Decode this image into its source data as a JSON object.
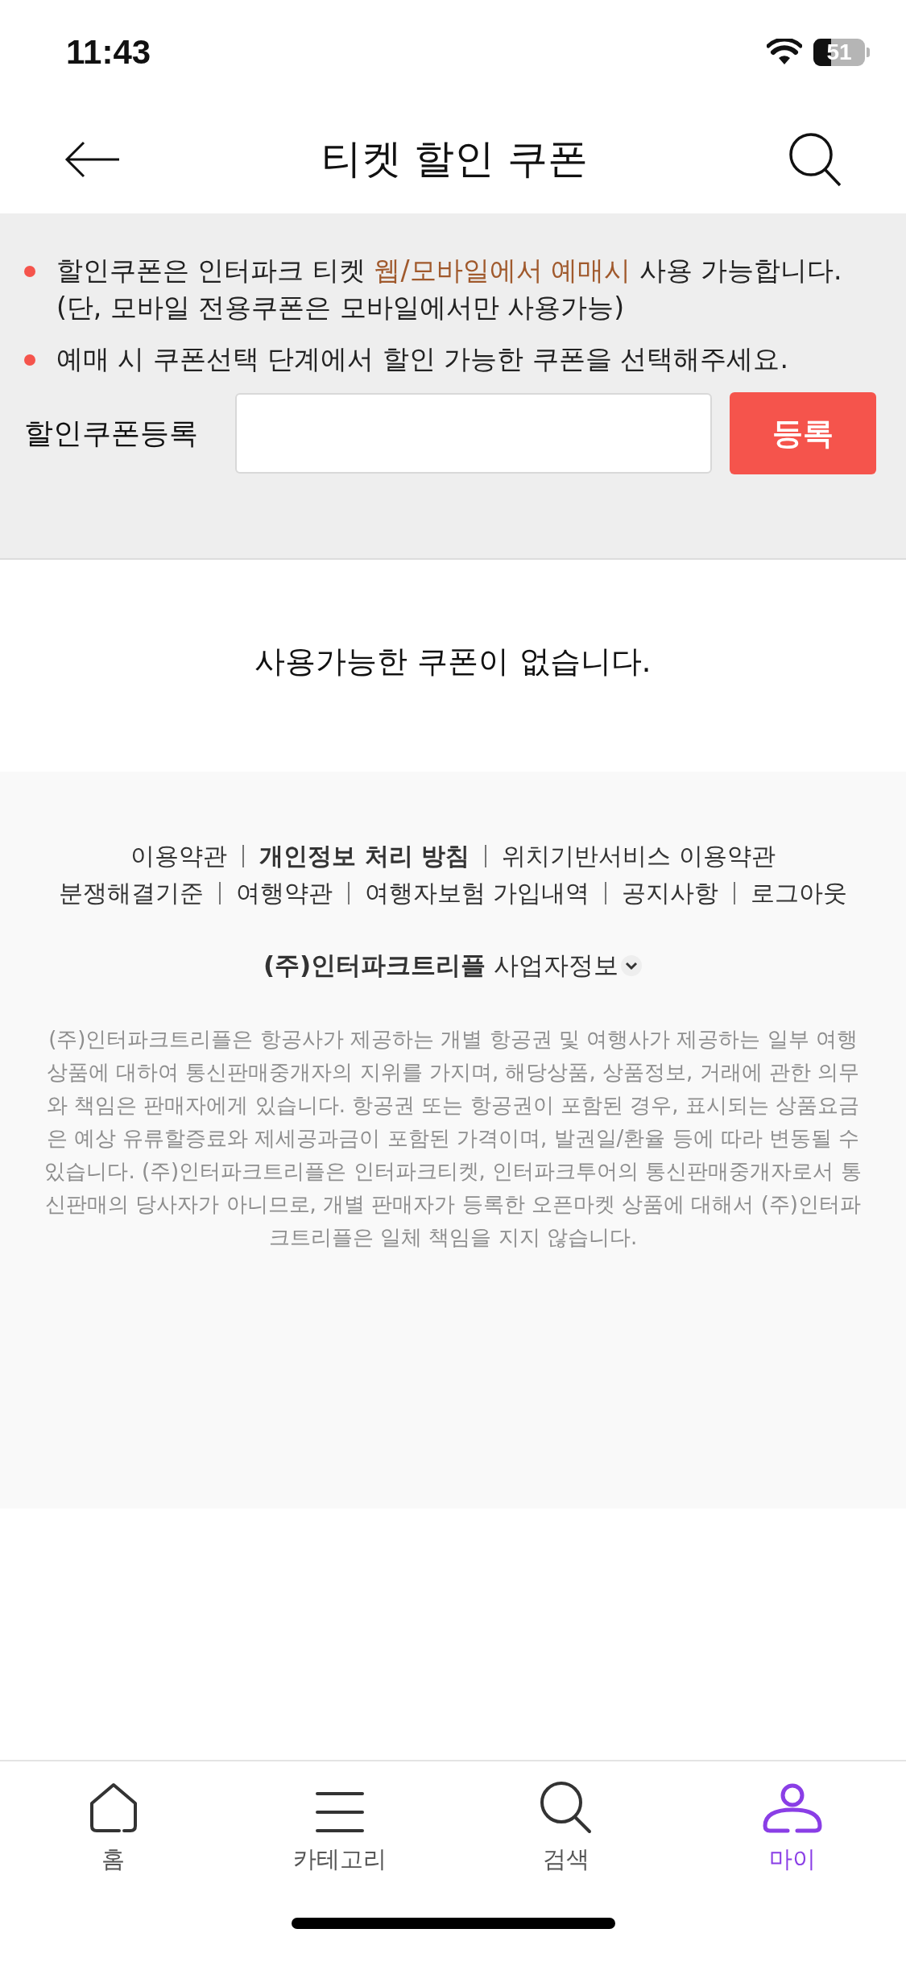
{
  "status_bar": {
    "time": "11:43",
    "battery": "51"
  },
  "header": {
    "title": "티켓 할인 쿠폰"
  },
  "notices": [
    {
      "parts": [
        {
          "text": "할인쿠폰은 인터파크 티켓 ",
          "highlight": false
        },
        {
          "text": "웹/모바일에서 예매시",
          "highlight": true
        },
        {
          "text": " 사용 가능합니다.",
          "highlight": false
        }
      ],
      "note": "(단, 모바일 전용쿠폰은 모바일에서만 사용가능)"
    },
    {
      "parts": [
        {
          "text": "예매 시 쿠폰선택 단계에서 할인 가능한 쿠폰을 선택해주세요.",
          "highlight": false
        }
      ]
    }
  ],
  "coupon_form": {
    "label": "할인쿠폰등록",
    "button": "등록"
  },
  "empty_message": "사용가능한 쿠폰이 없습니다.",
  "footer": {
    "link_rows": [
      [
        {
          "label": "이용약관",
          "bold": false
        },
        {
          "label": "개인정보 처리 방침",
          "bold": true
        },
        {
          "label": "위치기반서비스 이용약관",
          "bold": false
        }
      ],
      [
        {
          "label": "분쟁해결기준",
          "bold": false
        },
        {
          "label": "여행약관",
          "bold": false
        },
        {
          "label": "여행자보험 가입내역",
          "bold": false
        },
        {
          "label": "공지사항",
          "bold": false
        },
        {
          "label": "로그아웃",
          "bold": false
        }
      ]
    ],
    "business_info": {
      "label": "**(주)인터파크트리플** 사업자정보",
      "expanded": false
    },
    "disclaimer": "(주)인터파크트리플은 항공사가 제공하는 개별 항공권 및 여행사가 제공하는 일부 여행상품에 대하여 통신판매중개자의 지위를 가지며, 해당상품, 상품정보, 거래에 관한 의무와 책임은 판매자에게 있습니다. 항공권 또는 항공권이 포함된 경우, 표시되는 상품요금은 예상 유류할증료와 제세공과금이 포함된 가격이며, 발권일/환율 등에 따라 변동될 수 있습니다. (주)인터파크트리플은 인터파크티켓, 인터파크투어의 통신판매중개자로서 통신판매의 당사자가 아니므로, 개별 판매자가 등록한 오픈마켓 상품에 대해서 (주)인터파크트리플은 일체 책임을 지지 않습니다."
  },
  "bottom_nav": [
    {
      "kind": "home",
      "label": "홈",
      "selected": false
    },
    {
      "kind": "menu",
      "label": "카테고리",
      "selected": false
    },
    {
      "kind": "search",
      "label": "검색",
      "selected": false
    },
    {
      "kind": "person",
      "label": "마이",
      "selected": true
    }
  ]
}
